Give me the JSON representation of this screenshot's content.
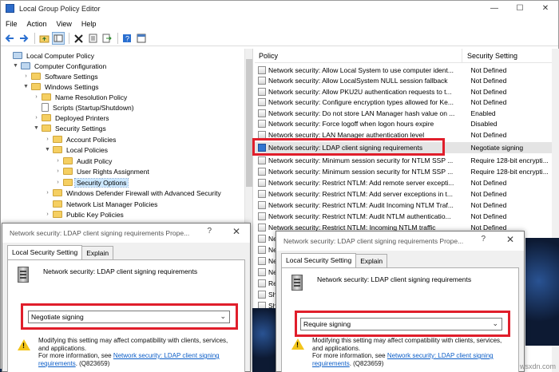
{
  "window": {
    "title": "Local Group Policy Editor",
    "minimize": "—",
    "maximize": "☐",
    "close": "✕"
  },
  "menu": [
    "File",
    "Action",
    "View",
    "Help"
  ],
  "toolbar_icons": [
    "back-icon",
    "forward-icon",
    "up-folder-icon",
    "show-hide-tree-icon",
    "delete-icon",
    "properties-icon",
    "export-icon",
    "help-icon",
    "console-icon"
  ],
  "tree": [
    {
      "label": "Local Computer Policy",
      "icon": "computer"
    },
    {
      "label": "Computer Configuration",
      "icon": "computer"
    },
    {
      "label": "Software Settings",
      "icon": "folder"
    },
    {
      "label": "Windows Settings",
      "icon": "folder"
    },
    {
      "label": "Name Resolution Policy",
      "icon": "folder"
    },
    {
      "label": "Scripts (Startup/Shutdown)",
      "icon": "doc"
    },
    {
      "label": "Deployed Printers",
      "icon": "folder"
    },
    {
      "label": "Security Settings",
      "icon": "folder"
    },
    {
      "label": "Account Policies",
      "icon": "folder"
    },
    {
      "label": "Local Policies",
      "icon": "folder"
    },
    {
      "label": "Audit Policy",
      "icon": "folder"
    },
    {
      "label": "User Rights Assignment",
      "icon": "folder"
    },
    {
      "label": "Security Options",
      "icon": "folder"
    },
    {
      "label": "Windows Defender Firewall with Advanced Security",
      "icon": "folder"
    },
    {
      "label": "Network List Manager Policies",
      "icon": "folder"
    },
    {
      "label": "Public Key Policies",
      "icon": "folder"
    }
  ],
  "list": {
    "col_policy": "Policy",
    "col_setting": "Security Setting",
    "rows": [
      {
        "policy": "Network security: Allow Local System to use computer ident...",
        "setting": "Not Defined"
      },
      {
        "policy": "Network security: Allow LocalSystem NULL session fallback",
        "setting": "Not Defined"
      },
      {
        "policy": "Network security: Allow PKU2U authentication requests to t...",
        "setting": "Not Defined"
      },
      {
        "policy": "Network security: Configure encryption types allowed for Ke...",
        "setting": "Not Defined"
      },
      {
        "policy": "Network security: Do not store LAN Manager hash value on ...",
        "setting": "Enabled"
      },
      {
        "policy": "Network security: Force logoff when logon hours expire",
        "setting": "Disabled"
      },
      {
        "policy": "Network security: LAN Manager authentication level",
        "setting": "Not Defined"
      },
      {
        "policy": "Network security: LDAP client signing requirements",
        "setting": "Negotiate signing"
      },
      {
        "policy": "Network security: Minimum session security for NTLM SSP ...",
        "setting": "Require 128-bit encrypti..."
      },
      {
        "policy": "Network security: Minimum session security for NTLM SSP ...",
        "setting": "Require 128-bit encrypti..."
      },
      {
        "policy": "Network security: Restrict NTLM: Add remote server excepti...",
        "setting": "Not Defined"
      },
      {
        "policy": "Network security: Restrict NTLM: Add server exceptions in t...",
        "setting": "Not Defined"
      },
      {
        "policy": "Network security: Restrict NTLM: Audit Incoming NTLM Traf...",
        "setting": "Not Defined"
      },
      {
        "policy": "Network security: Restrict NTLM: Audit NTLM authenticatio...",
        "setting": "Not Defined"
      },
      {
        "policy": "Network security: Restrict NTLM: Incoming NTLM traffic",
        "setting": "Not Defined"
      },
      {
        "policy": "Ne",
        "setting": ""
      },
      {
        "policy": "Ne",
        "setting": ""
      },
      {
        "policy": "Ne",
        "setting": ""
      },
      {
        "policy": "Ne",
        "setting": ""
      },
      {
        "policy": "Re",
        "setting": ""
      },
      {
        "policy": "Sh",
        "setting": ""
      },
      {
        "policy": "Sh",
        "setting": ""
      }
    ]
  },
  "dialog1": {
    "title": "Network security: LDAP client signing requirements Prope...",
    "help": "?",
    "close": "✕",
    "tab_local": "Local Security Setting",
    "tab_explain": "Explain",
    "policy_name": "Network security: LDAP client signing requirements",
    "selected_value": "Negotiate signing",
    "warning": "Modifying this setting may affect compatibility with clients, services, and applications.",
    "more_info": "For more information, see ",
    "link": "Network security: LDAP client signing requirements",
    "kb": ". (Q823659)"
  },
  "dialog2": {
    "title": "Network security: LDAP client signing requirements Prope...",
    "help": "?",
    "close": "✕",
    "tab_local": "Local Security Setting",
    "tab_explain": "Explain",
    "policy_name": "Network security: LDAP client signing requirements",
    "selected_value": "Require signing",
    "warning": "Modifying this setting may affect compatibility with clients, services, and applications.",
    "more_info": "For more information, see ",
    "link": "Network security: LDAP client signing requirements",
    "kb": ". (Q823659)"
  },
  "watermark": "wsxdn.com",
  "colors": {
    "highlight": "#e01e2b",
    "selection": "#cce8ff",
    "link": "#0b5dc7"
  }
}
